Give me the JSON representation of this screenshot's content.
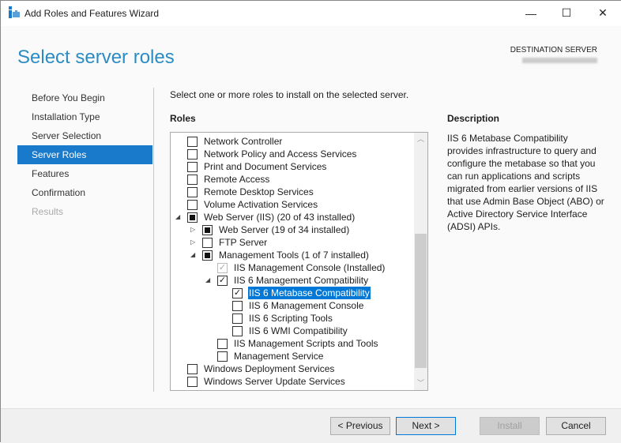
{
  "window": {
    "title": "Add Roles and Features Wizard",
    "icon": "server-manager-icon",
    "minimize": "—",
    "maximize": "☐",
    "close": "✕"
  },
  "header": {
    "title": "Select server roles",
    "destination_label": "DESTINATION SERVER"
  },
  "nav": [
    {
      "label": "Before You Begin",
      "state": "normal"
    },
    {
      "label": "Installation Type",
      "state": "normal"
    },
    {
      "label": "Server Selection",
      "state": "normal"
    },
    {
      "label": "Server Roles",
      "state": "selected"
    },
    {
      "label": "Features",
      "state": "normal"
    },
    {
      "label": "Confirmation",
      "state": "normal"
    },
    {
      "label": "Results",
      "state": "disabled"
    }
  ],
  "intro": "Select one or more roles to install on the selected server.",
  "roles": {
    "heading": "Roles",
    "items": [
      {
        "label": "Network Controller",
        "level": 0,
        "state": "unchecked"
      },
      {
        "label": "Network Policy and Access Services",
        "level": 0,
        "state": "unchecked"
      },
      {
        "label": "Print and Document Services",
        "level": 0,
        "state": "unchecked"
      },
      {
        "label": "Remote Access",
        "level": 0,
        "state": "unchecked"
      },
      {
        "label": "Remote Desktop Services",
        "level": 0,
        "state": "unchecked"
      },
      {
        "label": "Volume Activation Services",
        "level": 0,
        "state": "unchecked"
      },
      {
        "label": "Web Server (IIS) (20 of 43 installed)",
        "level": 0,
        "state": "indeterminate",
        "expander": "expanded"
      },
      {
        "label": "Web Server (19 of 34 installed)",
        "level": 1,
        "state": "indeterminate",
        "expander": "collapsed"
      },
      {
        "label": "FTP Server",
        "level": 1,
        "state": "unchecked",
        "expander": "collapsed"
      },
      {
        "label": "Management Tools (1 of 7 installed)",
        "level": 1,
        "state": "indeterminate",
        "expander": "expanded"
      },
      {
        "label": "IIS Management Console (Installed)",
        "level": 2,
        "state": "checked-disabled"
      },
      {
        "label": "IIS 6 Management Compatibility",
        "level": 2,
        "state": "checked",
        "expander": "expanded"
      },
      {
        "label": "IIS 6 Metabase Compatibility",
        "level": 3,
        "state": "checked",
        "selected": true
      },
      {
        "label": "IIS 6 Management Console",
        "level": 3,
        "state": "unchecked"
      },
      {
        "label": "IIS 6 Scripting Tools",
        "level": 3,
        "state": "unchecked"
      },
      {
        "label": "IIS 6 WMI Compatibility",
        "level": 3,
        "state": "unchecked"
      },
      {
        "label": "IIS Management Scripts and Tools",
        "level": 2,
        "state": "unchecked"
      },
      {
        "label": "Management Service",
        "level": 2,
        "state": "unchecked"
      },
      {
        "label": "Windows Deployment Services",
        "level": 0,
        "state": "unchecked"
      },
      {
        "label": "Windows Server Update Services",
        "level": 0,
        "state": "unchecked"
      }
    ]
  },
  "description": {
    "heading": "Description",
    "text": "IIS 6 Metabase Compatibility provides infrastructure to query and configure the metabase so that you can run applications and scripts migrated from earlier versions of IIS that use Admin Base Object (ABO) or Active Directory Service Interface (ADSI) APIs."
  },
  "buttons": {
    "previous": "< Previous",
    "next": "Next >",
    "install": "Install",
    "cancel": "Cancel"
  },
  "colors": {
    "accent": "#1979ca",
    "title": "#2b8cc4",
    "selection": "#0078d7"
  }
}
